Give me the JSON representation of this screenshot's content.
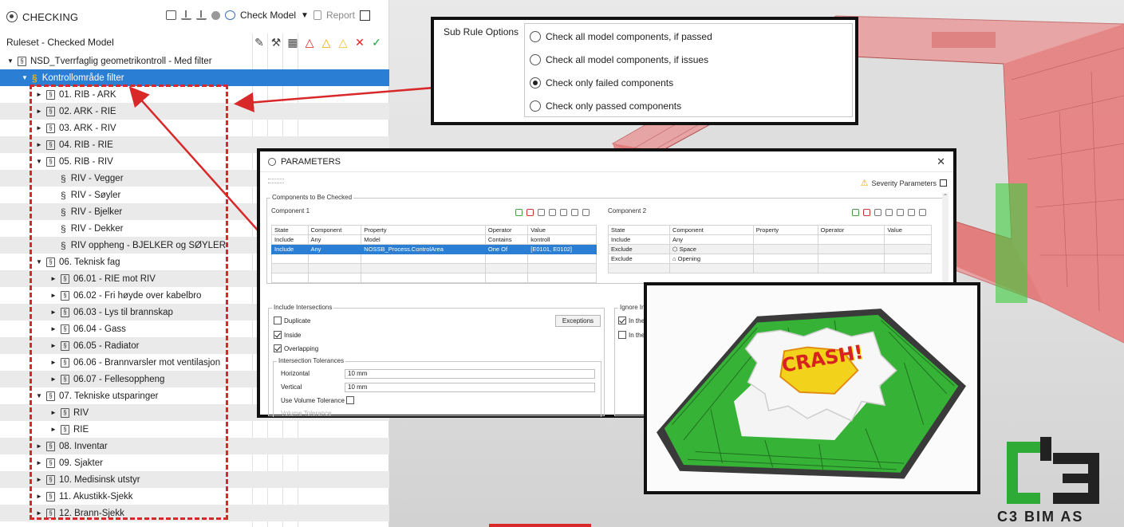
{
  "checking": {
    "title": "CHECKING",
    "check_model_label": "Check Model",
    "report_label": "Report",
    "ruleset_label": "Ruleset - Checked Model",
    "rows": [
      {
        "label": "NSD_Tverrfaglig geometrikontroll - Med filter",
        "kind": "ruleset",
        "arrow": "▼",
        "selected": false
      },
      {
        "label": "Kontrollområde filter",
        "kind": "section",
        "arrow": "▼",
        "selected": true
      },
      {
        "label": "01. RIB - ARK",
        "kind": "ruleset",
        "arrow": "►",
        "selected": false
      },
      {
        "label": "02. ARK - RIE",
        "kind": "ruleset",
        "arrow": "►",
        "selected": false
      },
      {
        "label": "03. ARK - RIV",
        "kind": "ruleset",
        "arrow": "►",
        "selected": false
      },
      {
        "label": "04. RIB - RIE",
        "kind": "ruleset",
        "arrow": "►",
        "selected": false
      },
      {
        "label": "05. RIB - RIV",
        "kind": "ruleset",
        "arrow": "▼",
        "selected": false
      },
      {
        "label": "RIV - Vegger",
        "kind": "section",
        "arrow": "",
        "selected": false
      },
      {
        "label": "RIV - Søyler",
        "kind": "section",
        "arrow": "",
        "selected": false
      },
      {
        "label": "RIV - Bjelker",
        "kind": "section",
        "arrow": "",
        "selected": false
      },
      {
        "label": "RIV - Dekker",
        "kind": "section",
        "arrow": "",
        "selected": false
      },
      {
        "label": "RIV oppheng - BJELKER og SØYLER",
        "kind": "section",
        "arrow": "",
        "selected": false
      },
      {
        "label": "06. Teknisk fag",
        "kind": "ruleset",
        "arrow": "▼",
        "selected": false
      },
      {
        "label": "06.01 - RIE mot RIV",
        "kind": "ruleset",
        "arrow": "►",
        "selected": false
      },
      {
        "label": "06.02 - Fri høyde over kabelbro",
        "kind": "ruleset",
        "arrow": "►",
        "selected": false
      },
      {
        "label": "06.03 - Lys til brannskap",
        "kind": "ruleset",
        "arrow": "►",
        "selected": false
      },
      {
        "label": "06.04 - Gass",
        "kind": "ruleset",
        "arrow": "►",
        "selected": false
      },
      {
        "label": "06.05 - Radiator",
        "kind": "ruleset",
        "arrow": "►",
        "selected": false
      },
      {
        "label": "06.06 - Brannvarsler mot ventilasjon",
        "kind": "ruleset",
        "arrow": "►",
        "selected": false
      },
      {
        "label": "06.07 - Fellesoppheng",
        "kind": "ruleset",
        "arrow": "►",
        "selected": false
      },
      {
        "label": "07. Tekniske utsparinger",
        "kind": "ruleset",
        "arrow": "▼",
        "selected": false
      },
      {
        "label": "RIV",
        "kind": "ruleset",
        "arrow": "►",
        "selected": false
      },
      {
        "label": "RIE",
        "kind": "ruleset",
        "arrow": "►",
        "selected": false
      },
      {
        "label": "08. Inventar",
        "kind": "ruleset",
        "arrow": "►",
        "selected": false
      },
      {
        "label": "09. Sjakter",
        "kind": "ruleset",
        "arrow": "►",
        "selected": false
      },
      {
        "label": "10. Medisinsk utstyr",
        "kind": "ruleset",
        "arrow": "►",
        "selected": false
      },
      {
        "label": "11. Akustikk-Sjekk",
        "kind": "ruleset",
        "arrow": "►",
        "selected": false
      },
      {
        "label": "12. Brann-Sjekk",
        "kind": "ruleset",
        "arrow": "►",
        "selected": false
      }
    ]
  },
  "sub_rule": {
    "label": "Sub Rule Options",
    "options": [
      {
        "label": "Check all model components, if passed",
        "checked": false
      },
      {
        "label": "Check all model components, if issues",
        "checked": false
      },
      {
        "label": "Check only failed components",
        "checked": true
      },
      {
        "label": "Check only passed components",
        "checked": false
      }
    ]
  },
  "params": {
    "title": "PARAMETERS",
    "close": "✕",
    "severity_label": "Severity Parameters",
    "components_legend": "Components to Be Checked",
    "component1_label": "Component 1",
    "component2_label": "Component 2",
    "c1_headers": [
      "State",
      "Component",
      "Property",
      "Operator",
      "Value"
    ],
    "c1_rows": [
      [
        "Include",
        "Any",
        "Model",
        "Contains",
        "kontroll"
      ],
      [
        "Include",
        "Any",
        "NOSSB_Process.ControlArea",
        "One Of",
        "[E0101, E0102]"
      ]
    ],
    "c2_headers": [
      "State",
      "Component",
      "Property",
      "Operator",
      "Value"
    ],
    "c2_rows": [
      [
        "Include",
        "Any",
        "",
        "",
        ""
      ],
      [
        "Exclude",
        "⬡ Space",
        "",
        "",
        ""
      ],
      [
        "Exclude",
        "⌂ Opening",
        "",
        "",
        ""
      ]
    ],
    "include_intersections_legend": "Include Intersections",
    "duplicate_label": "Duplicate",
    "inside_label": "Inside",
    "overlapping_label": "Overlapping",
    "exceptions_label": "Exceptions",
    "tolerances_legend": "Intersection Tolerances",
    "horizontal_label": "Horizontal",
    "horizontal_value": "10 mm",
    "vertical_label": "Vertical",
    "vertical_value": "10 mm",
    "use_volume_label": "Use Volume Tolerance",
    "volume_tolerance_label": "Volume Tolerance",
    "ignore_legend": "Ignore Inte",
    "ignore_opt1": "In the",
    "ignore_opt2": "In the"
  },
  "crash": {
    "text": "CRASH!"
  },
  "logo": {
    "text": "C3 BIM AS"
  },
  "colors": {
    "selection": "#2a7fd4",
    "callout_border": "#111111",
    "arrow_red": "#d8282a",
    "model_red": "#e35a5a",
    "model_green": "#2fc22f"
  }
}
